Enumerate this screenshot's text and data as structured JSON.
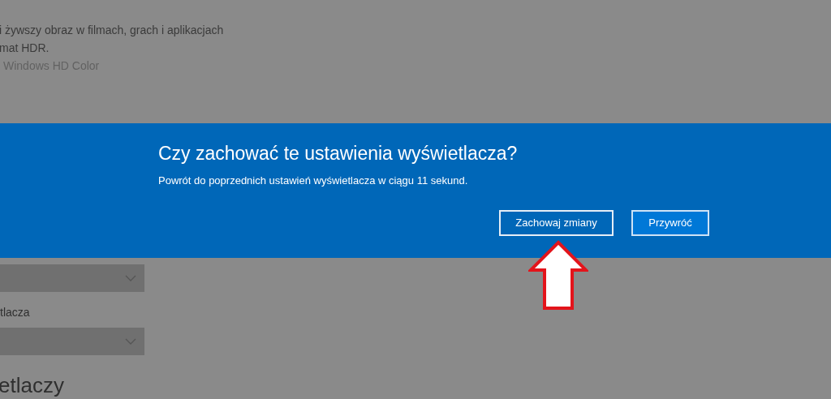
{
  "background": {
    "description_lines": [
      "i żywszy obraz w filmach, grach i aplikacjach",
      "mat HDR."
    ],
    "link": "Windows HD Color",
    "dropdown_label": "tlacza",
    "heading": "etlaczy"
  },
  "dialog": {
    "title": "Czy zachować te ustawienia wyświetlacza?",
    "message": "Powrót do poprzednich ustawień wyświetlacza w ciągu 11 sekund.",
    "buttons": [
      {
        "label": "Zachowaj zmiany",
        "kind": "outline"
      },
      {
        "label": "Przywróć",
        "kind": "filled"
      }
    ]
  }
}
